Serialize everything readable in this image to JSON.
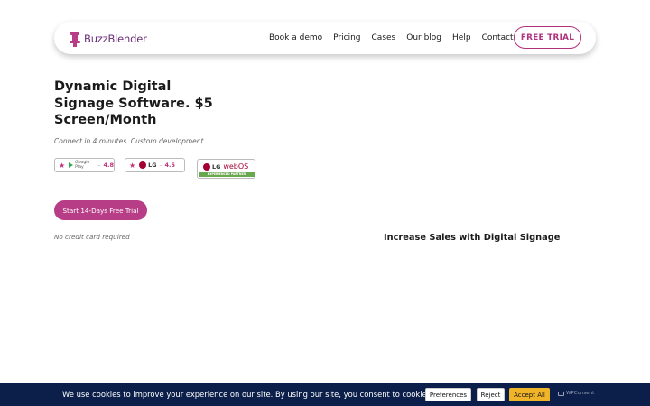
{
  "brand": {
    "name": "BuzzBlender",
    "color": "#6b2f7a"
  },
  "nav": {
    "links": [
      "Book a demo",
      "Pricing",
      "Cases",
      "Our blog",
      "Help",
      "Contact us"
    ],
    "cta_label": "FREE TRIAL",
    "accent": "#b0317d"
  },
  "hero": {
    "title": "Dynamic Digital Signage Software. $5 Screen/Month",
    "subtitle": "Connect in 4 minutes. Custom development.",
    "cta_label": "Start 14-Days Free Trial",
    "note": "No credit card required"
  },
  "badges": {
    "google_play": {
      "label": "Google Play",
      "rating": "4.8"
    },
    "lg": {
      "label": "LG",
      "rating": "4.5"
    },
    "webos": {
      "brand": "LG",
      "platform": "webOS",
      "tag": "EXPERIENCED PARTNER"
    }
  },
  "side": {
    "heading": "Increase Sales with Digital Signage"
  },
  "cookie": {
    "message": "We use cookies to improve your experience on our site. By using our site, you consent to cookies.",
    "preferences_label": "Preferences",
    "reject_label": "Reject",
    "accept_label": "Accept All",
    "powered_by": "WPConsent",
    "background": "#0b1f4a",
    "accept_color": "#f0b429"
  }
}
